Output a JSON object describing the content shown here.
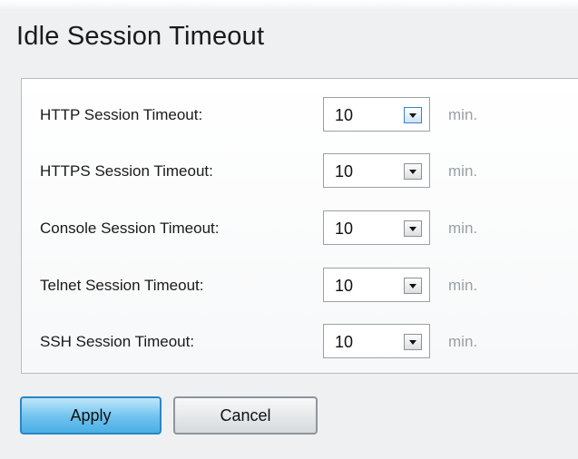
{
  "page": {
    "title": "Idle Session Timeout"
  },
  "settings": [
    {
      "label": "HTTP Session Timeout:",
      "value": "10",
      "unit": "min."
    },
    {
      "label": "HTTPS Session Timeout:",
      "value": "10",
      "unit": "min."
    },
    {
      "label": "Console Session Timeout:",
      "value": "10",
      "unit": "min."
    },
    {
      "label": "Telnet Session Timeout:",
      "value": "10",
      "unit": "min."
    },
    {
      "label": "SSH Session Timeout:",
      "value": "10",
      "unit": "min."
    }
  ],
  "buttons": {
    "apply_label": "Apply",
    "cancel_label": "Cancel"
  },
  "colors": {
    "background": "#eef0f2",
    "apply_button": "#6fc2ee",
    "cancel_button": "#d6dadd",
    "unit_text": "#9aa0a6"
  }
}
